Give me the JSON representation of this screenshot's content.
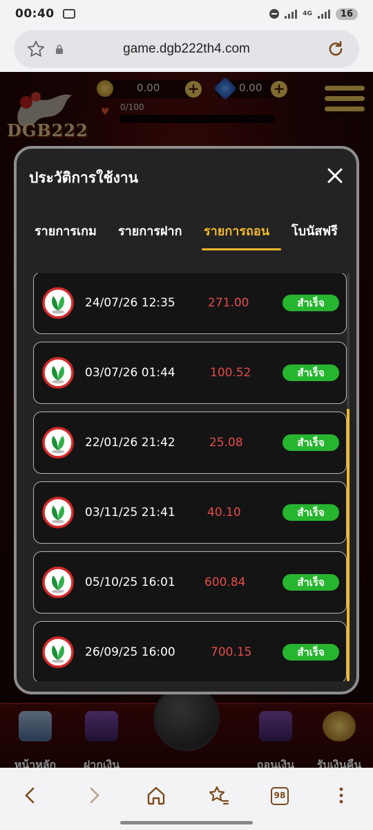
{
  "status": {
    "time": "00:40",
    "network": "4G",
    "battery": "16"
  },
  "browser": {
    "url": "game.dgb222th4.com"
  },
  "game": {
    "logo_text": "DGB222",
    "coins": "0.00",
    "gems": "0.00",
    "xp": "0/100",
    "bottom_nav": [
      {
        "label": "หน้าหลัก",
        "icon": "house-icon"
      },
      {
        "label": "ฝากเงิน",
        "icon": "atm-deposit-icon"
      },
      {
        "label": "ถอนเงิน",
        "icon": "atm-withdraw-icon"
      },
      {
        "label": "รับเงินคืน",
        "icon": "cashback-icon"
      }
    ]
  },
  "modal": {
    "title": "ประวัติการใช้งาน",
    "tabs": [
      {
        "label": "รายการเกม",
        "active": false
      },
      {
        "label": "รายการฝาก",
        "active": false
      },
      {
        "label": "รายการถอน",
        "active": true
      },
      {
        "label": "โบนัสฟรี",
        "active": false
      }
    ],
    "transactions": [
      {
        "date": "24/07/26 12:35",
        "amount": "271.00",
        "status": "สำเร็จ",
        "bank": "kasikorn-bank-icon"
      },
      {
        "date": "03/07/26 01:44",
        "amount": "100.52",
        "status": "สำเร็จ",
        "bank": "kasikorn-bank-icon"
      },
      {
        "date": "22/01/26 21:42",
        "amount": "25.08",
        "status": "สำเร็จ",
        "bank": "kasikorn-bank-icon"
      },
      {
        "date": "03/11/25 21:41",
        "amount": "40.10",
        "status": "สำเร็จ",
        "bank": "kasikorn-bank-icon"
      },
      {
        "date": "05/10/25 16:01",
        "amount": "600.84",
        "status": "สำเร็จ",
        "bank": "kasikorn-bank-icon"
      },
      {
        "date": "26/09/25 16:00",
        "amount": "700.15",
        "status": "สำเร็จ",
        "bank": "kasikorn-bank-icon"
      }
    ]
  },
  "browser_nav": {
    "tab_count": "98"
  },
  "colors": {
    "accent": "#f2b92b",
    "success": "#27b530",
    "amount": "#e64b4b",
    "brand_red": "#5a0d0d"
  }
}
